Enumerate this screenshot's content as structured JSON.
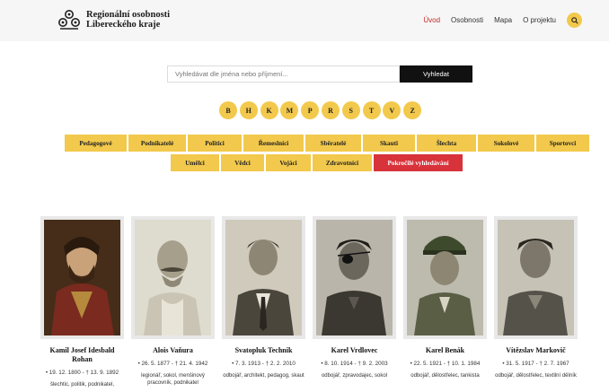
{
  "header": {
    "brand_line1": "Regionální osobnosti",
    "brand_line2": "Libereckého kraje",
    "nav": [
      "Úvod",
      "Osobnosti",
      "Mapa",
      "O projektu"
    ],
    "active_nav": "Úvod",
    "accent": "#f2c94c",
    "active_color": "#c62a2a"
  },
  "search": {
    "placeholder": "Vyhledávat dle jména nebo příjmení...",
    "button": "Vyhledat"
  },
  "letters": [
    "B",
    "H",
    "K",
    "M",
    "P",
    "R",
    "S",
    "T",
    "V",
    "Z"
  ],
  "categories_row1": [
    "Pedagogové",
    "Podnikatelé",
    "Politici",
    "Řemeslníci",
    "Sběratelé",
    "Skauti",
    "Šlechta",
    "Sokolové",
    "Sportovci"
  ],
  "categories_row2": [
    "Umělci",
    "Vědci",
    "Vojáci",
    "Zdravotníci"
  ],
  "advanced_search": "Pokročilé vyhledávání",
  "persons": [
    {
      "name": "Kamil Josef Idesbald Rohan",
      "dates": "• 19. 12. 1800 - † 13. 9. 1892",
      "desc": "šlechtic, politik, podnikatel,"
    },
    {
      "name": "Alois Vaňura",
      "dates": "• 26. 5. 1877 - † 21. 4. 1942",
      "desc": "legionář, sokol, menšinový pracovník, podnikatel"
    },
    {
      "name": "Svatopluk Technik",
      "dates": "• 7. 3. 1913 - † 2. 2. 2010",
      "desc": "odbojář, architekt, pedagog, skaut"
    },
    {
      "name": "Karel Vrdlovec",
      "dates": "• 8. 10. 1914 - † 9. 2. 2003",
      "desc": "odbojář, zpravodajec, sokol"
    },
    {
      "name": "Karel Benák",
      "dates": "• 22. 5. 1921 - † 10. 1. 1984",
      "desc": "odbojář, dělostřelec, tankista"
    },
    {
      "name": "Vítězslav Markovič",
      "dates": "• 31. 5. 1917 - † 2. 7. 1967",
      "desc": "odbojář, dělostřelec, textilní dělník"
    }
  ]
}
